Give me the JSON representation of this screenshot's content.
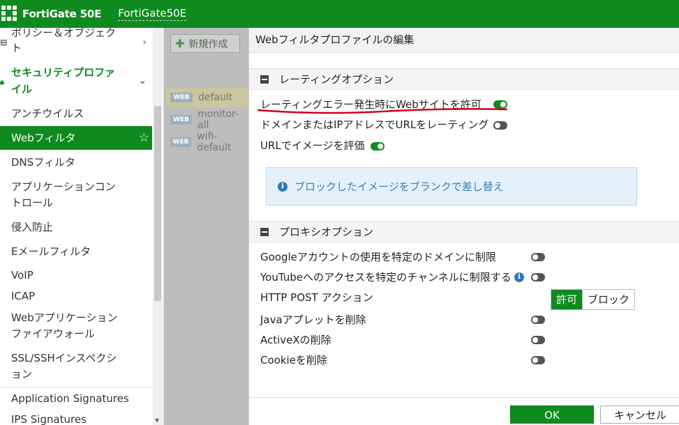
{
  "topbar": {
    "brand": "FortiGate 50E",
    "hostname": "FortiGate50E"
  },
  "sidebar": {
    "items": [
      {
        "label": "ポリシー＆オブジェクト",
        "icon": "policy-icon"
      },
      {
        "label": "セキュリティプロファイル",
        "icon": "lock-icon"
      },
      {
        "label": "アンチウイルス"
      },
      {
        "label": "Webフィルタ"
      },
      {
        "label": "DNSフィルタ"
      },
      {
        "label": "アプリケーションコントロール"
      },
      {
        "label": "侵入防止"
      },
      {
        "label": "Eメールフィルタ"
      },
      {
        "label": "VoIP"
      },
      {
        "label": "ICAP"
      },
      {
        "label": "Webアプリケーションファイアウォール"
      },
      {
        "label": "SSL/SSHインスペクション"
      },
      {
        "label": "Application Signatures"
      },
      {
        "label": "IPS Signatures"
      }
    ]
  },
  "content": {
    "create_label": "新規作成",
    "badge": "WEB",
    "rows": [
      "default",
      "monitor-all",
      "wifi-default"
    ]
  },
  "modal": {
    "title": "Webフィルタプロファイルの編集",
    "rating_section": "レーティングオプション",
    "rating_options": [
      {
        "label": "レーティングエラー発生時にWebサイトを許可",
        "state": "on"
      },
      {
        "label": "ドメインまたはIPアドレスでURLをレーティング",
        "state": "off"
      },
      {
        "label": "URLでイメージを評価",
        "state": "on"
      }
    ],
    "info_text": "ブロックしたイメージをブランクで差し替え",
    "proxy_section": "プロキシオプション",
    "proxy_options": [
      {
        "label": "Googleアカウントの使用を特定のドメインに制限",
        "state": "off"
      },
      {
        "label": "YouTubeへのアクセスを特定のチャンネルに制限する",
        "state": "off"
      },
      {
        "label": "HTTP POST アクション"
      },
      {
        "label": "Javaアプレットを削除",
        "state": "off"
      },
      {
        "label": "ActiveXの削除",
        "state": "off"
      },
      {
        "label": "Cookieを削除",
        "state": "off"
      }
    ],
    "post_action": {
      "allow": "許可",
      "block": "ブロック",
      "selected": "許可"
    },
    "ok_label": "OK",
    "cancel_label": "キャンセル"
  },
  "colors": {
    "brand_green": "#0f8a1f",
    "info_blue": "#3b7fb1",
    "annotation_red": "#d0021b"
  }
}
